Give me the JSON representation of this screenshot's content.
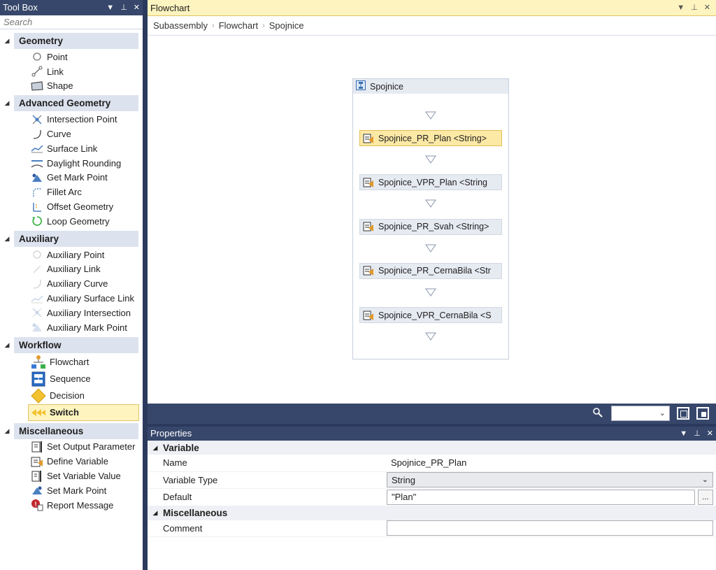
{
  "toolbox": {
    "title": "Tool Box",
    "search_placeholder": "Search",
    "groups": [
      {
        "label": "Geometry",
        "items": [
          {
            "label": "Point",
            "icon": "point-icon"
          },
          {
            "label": "Link",
            "icon": "link-icon"
          },
          {
            "label": "Shape",
            "icon": "shape-icon"
          }
        ]
      },
      {
        "label": "Advanced Geometry",
        "items": [
          {
            "label": "Intersection Point",
            "icon": "intersection-point-icon"
          },
          {
            "label": "Curve",
            "icon": "curve-icon"
          },
          {
            "label": "Surface Link",
            "icon": "surface-link-icon"
          },
          {
            "label": "Daylight Rounding",
            "icon": "daylight-rounding-icon"
          },
          {
            "label": "Get Mark Point",
            "icon": "get-mark-point-icon"
          },
          {
            "label": "Fillet Arc",
            "icon": "fillet-arc-icon"
          },
          {
            "label": "Offset Geometry",
            "icon": "offset-geometry-icon"
          },
          {
            "label": "Loop Geometry",
            "icon": "loop-geometry-icon"
          }
        ]
      },
      {
        "label": "Auxiliary",
        "items": [
          {
            "label": "Auxiliary Point",
            "icon": "auxiliary-point-icon"
          },
          {
            "label": "Auxiliary Link",
            "icon": "auxiliary-link-icon"
          },
          {
            "label": "Auxiliary Curve",
            "icon": "auxiliary-curve-icon"
          },
          {
            "label": "Auxiliary Surface Link",
            "icon": "auxiliary-surface-link-icon"
          },
          {
            "label": "Auxiliary Intersection",
            "icon": "auxiliary-intersection-icon"
          },
          {
            "label": "Auxiliary Mark Point",
            "icon": "auxiliary-mark-point-icon"
          }
        ]
      },
      {
        "label": "Workflow",
        "items": [
          {
            "label": "Flowchart",
            "icon": "flowchart-icon"
          },
          {
            "label": "Sequence",
            "icon": "sequence-icon"
          },
          {
            "label": "Decision",
            "icon": "decision-icon"
          },
          {
            "label": "Switch",
            "icon": "switch-icon",
            "selected": true
          }
        ]
      },
      {
        "label": "Miscellaneous",
        "items": [
          {
            "label": "Set Output Parameter",
            "icon": "set-output-parameter-icon"
          },
          {
            "label": "Define Variable",
            "icon": "define-variable-icon"
          },
          {
            "label": "Set Variable Value",
            "icon": "set-variable-value-icon"
          },
          {
            "label": "Set Mark Point",
            "icon": "set-mark-point-icon"
          },
          {
            "label": "Report Message",
            "icon": "report-message-icon"
          }
        ]
      }
    ]
  },
  "document": {
    "title": "Flowchart",
    "breadcrumb": [
      "Subassembly",
      "Flowchart",
      "Spojnice"
    ],
    "flowchart": {
      "container_title": "Spojnice",
      "items": [
        {
          "label": "Spojnice_PR_Plan <String>",
          "selected": true
        },
        {
          "label": "Spojnice_VPR_Plan <String",
          "selected": false
        },
        {
          "label": "Spojnice_PR_Svah <String>",
          "selected": false
        },
        {
          "label": "Spojnice_PR_CernaBila <Str",
          "selected": false
        },
        {
          "label": "Spojnice_VPR_CernaBila <S",
          "selected": false
        }
      ]
    },
    "zoom_value": ""
  },
  "properties": {
    "title": "Properties",
    "sections": [
      {
        "label": "Variable",
        "rows": [
          {
            "key": "Name",
            "value": "Spojnice_PR_Plan",
            "kind": "text"
          },
          {
            "key": "Variable Type",
            "value": "String",
            "kind": "combo"
          },
          {
            "key": "Default",
            "value": "\"Plan\"",
            "kind": "field-ellipsis"
          }
        ]
      },
      {
        "label": "Miscellaneous",
        "rows": [
          {
            "key": "Comment",
            "value": "",
            "kind": "field"
          }
        ]
      }
    ],
    "ellipsis_label": "..."
  },
  "colors": {
    "titlebar": "#37476b",
    "highlight": "#fdf4bf",
    "group_header": "#dde3ee"
  }
}
